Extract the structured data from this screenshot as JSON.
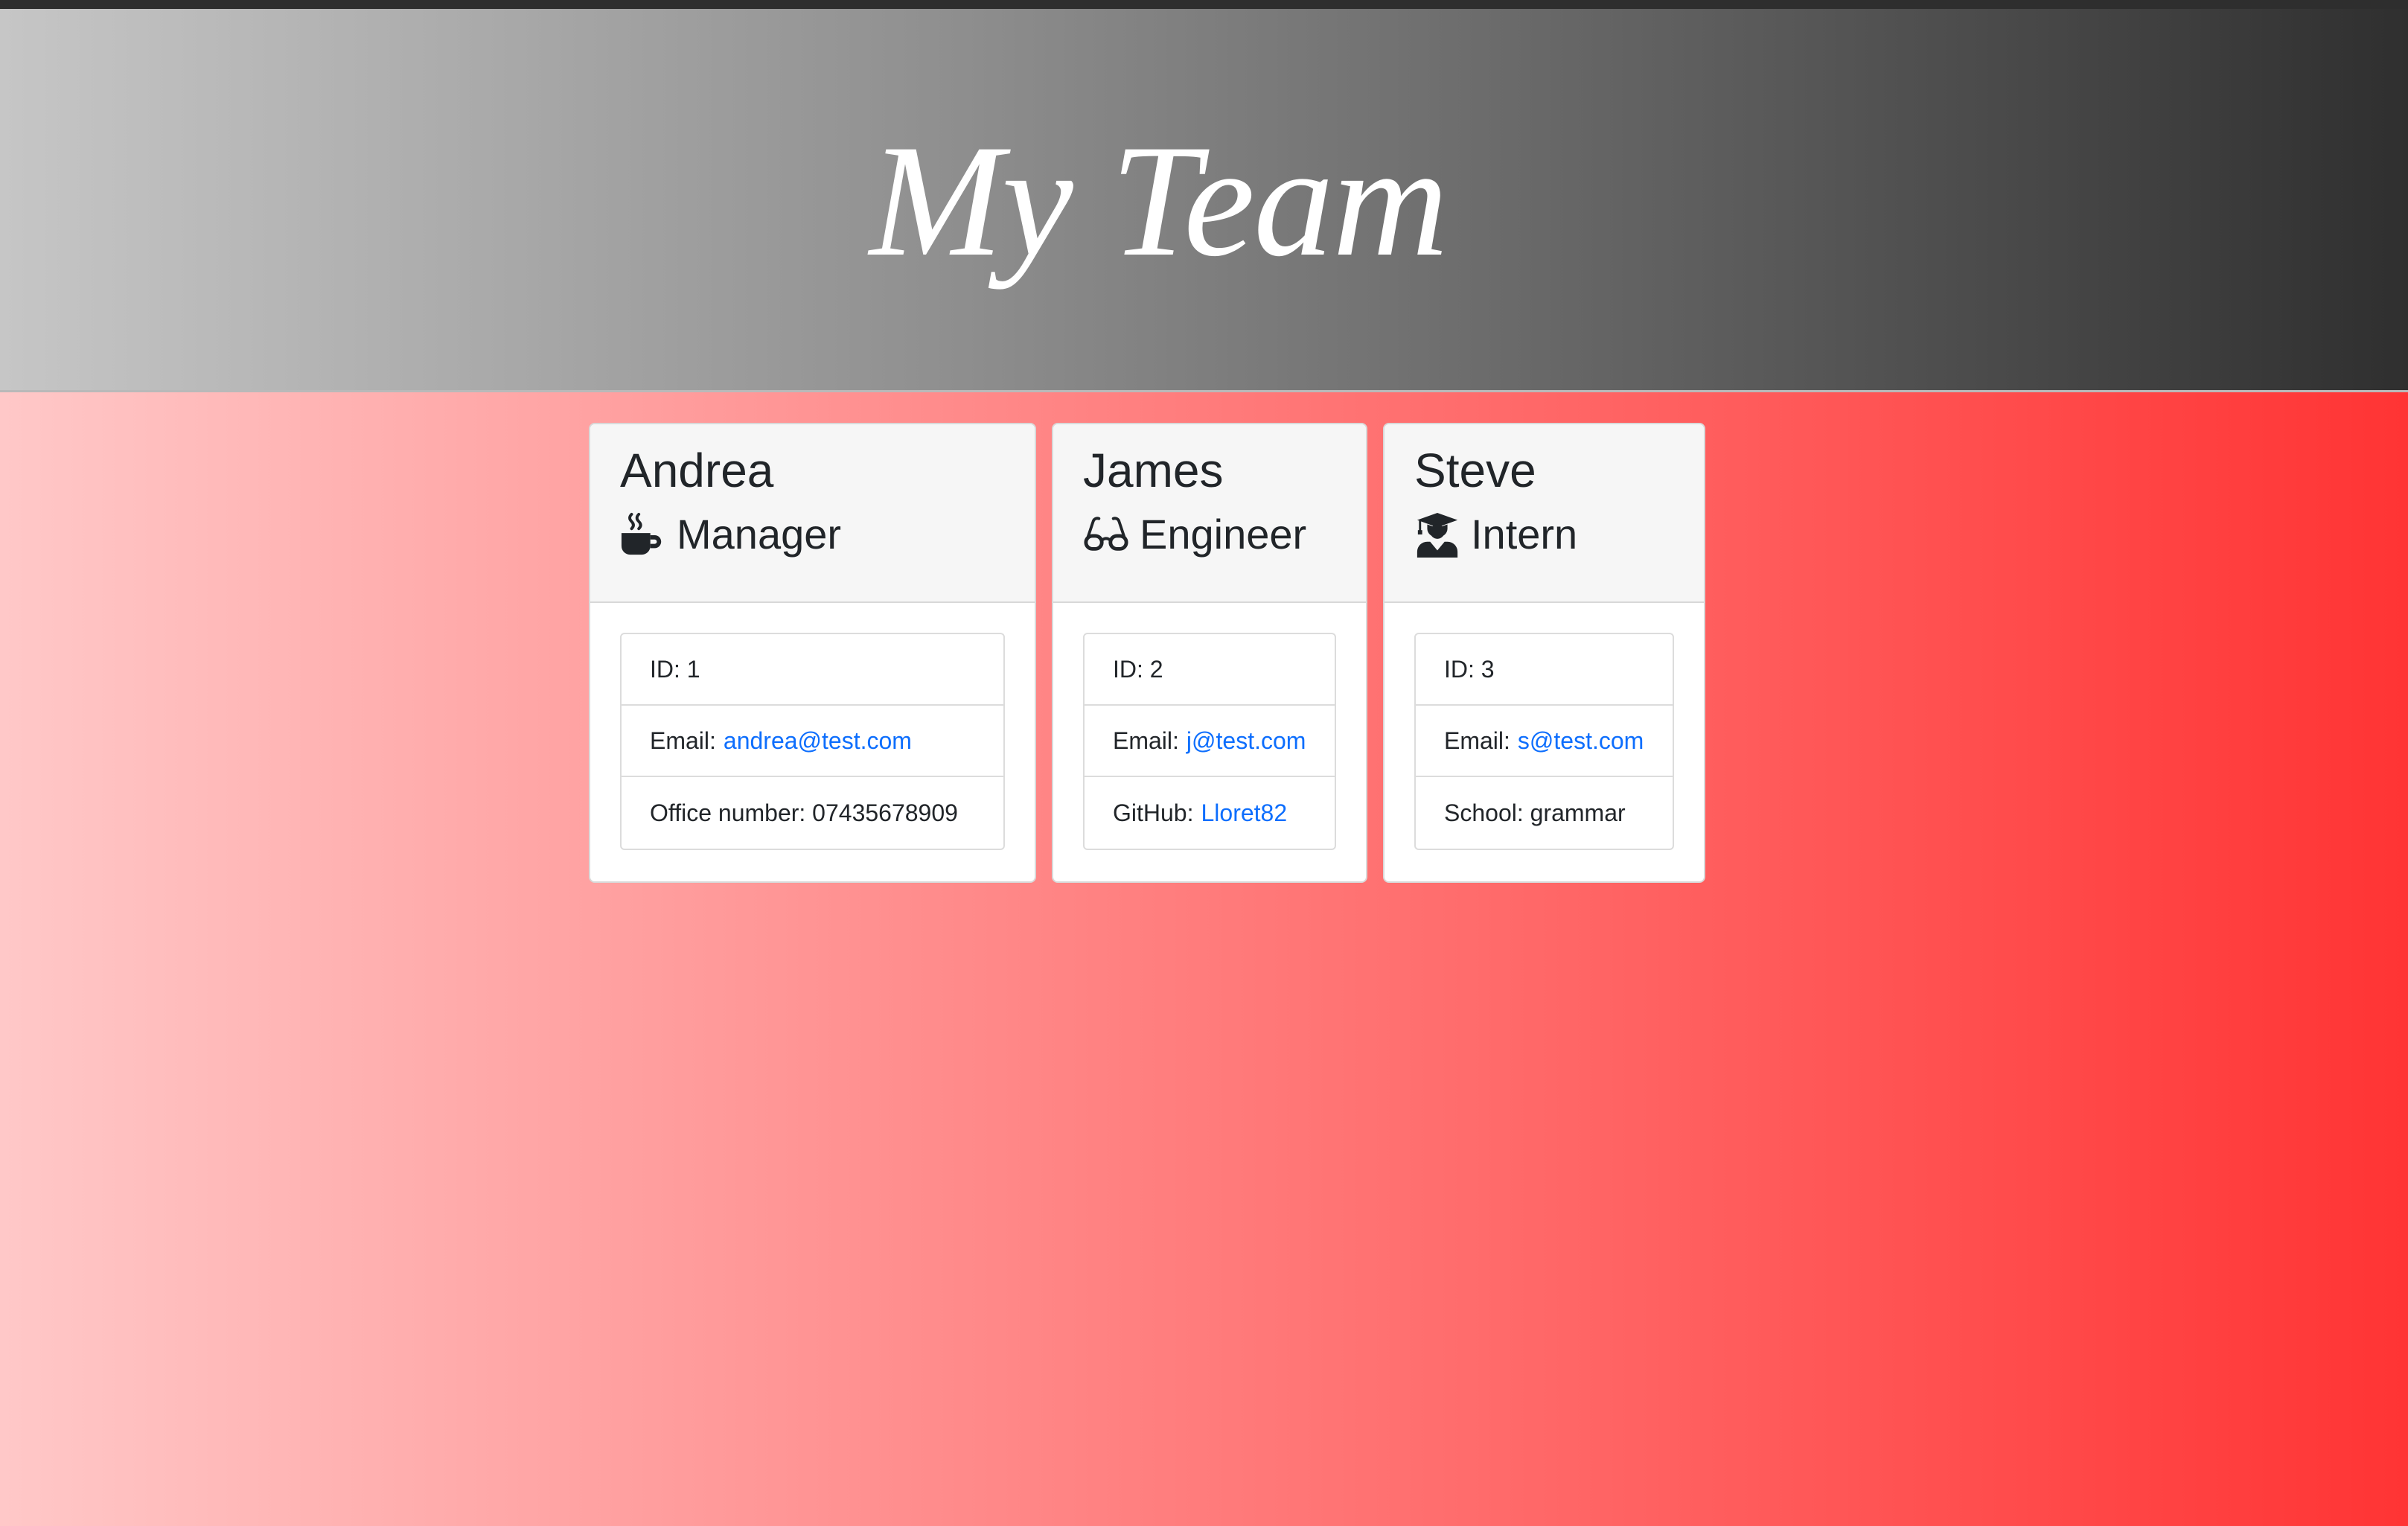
{
  "header": {
    "title": "My Team"
  },
  "employees": [
    {
      "name": "Andrea",
      "role": "Manager",
      "role_icon": "mug-hot-icon",
      "id_label": "ID: 1",
      "email_prefix": "Email:",
      "email": "andrea@test.com",
      "extra_prefix": "Office number: 07435678909",
      "extra_link": ""
    },
    {
      "name": "James",
      "role": "Engineer",
      "role_icon": "glasses-icon",
      "id_label": "ID: 2",
      "email_prefix": "Email:",
      "email": "j@test.com",
      "extra_prefix": "GitHub:",
      "extra_link": "Lloret82"
    },
    {
      "name": "Steve",
      "role": "Intern",
      "role_icon": "user-graduate-icon",
      "id_label": "ID: 3",
      "email_prefix": "Email:",
      "email": "s@test.com",
      "extra_prefix": "School: grammar",
      "extra_link": ""
    }
  ],
  "colors": {
    "link": "#0d6efd",
    "text": "#212529",
    "header_gradient_start": "#c6c6c6",
    "header_gradient_end": "#2f2f2f",
    "page_gradient_start": "#ffc8c8",
    "page_gradient_end": "#ff3434"
  }
}
